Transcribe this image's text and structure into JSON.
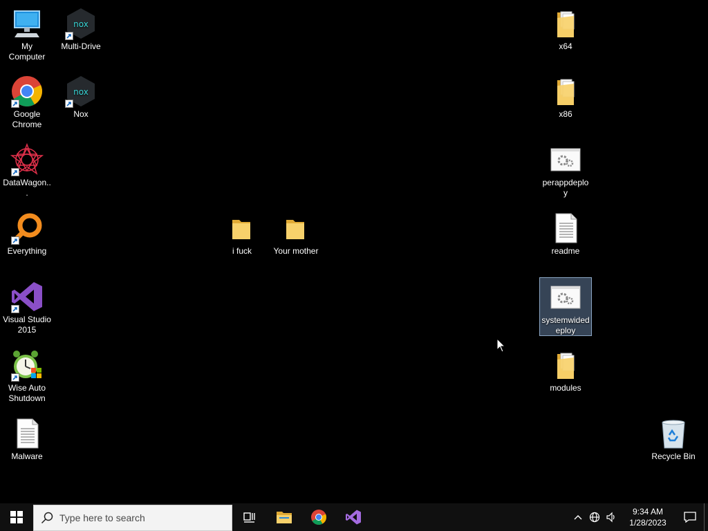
{
  "desktop": {
    "icons": [
      {
        "id": "my-computer",
        "label": "My Computer"
      },
      {
        "id": "multi-drive",
        "label": "Multi-Drive"
      },
      {
        "id": "google-chrome",
        "label": "Google Chrome"
      },
      {
        "id": "nox",
        "label": "Nox"
      },
      {
        "id": "datawagon",
        "label": "DataWagon..."
      },
      {
        "id": "everything",
        "label": "Everything"
      },
      {
        "id": "visual-studio",
        "label": "Visual Studio 2015"
      },
      {
        "id": "wise-auto-shutdown",
        "label": "Wise Auto Shutdown"
      },
      {
        "id": "malware",
        "label": "Malware"
      },
      {
        "id": "i-fuck",
        "label": "i fuck"
      },
      {
        "id": "your-mother",
        "label": "Your mother"
      },
      {
        "id": "x64",
        "label": "x64"
      },
      {
        "id": "x86",
        "label": "x86"
      },
      {
        "id": "perappdeploy",
        "label": "perappdeploy"
      },
      {
        "id": "readme",
        "label": "readme"
      },
      {
        "id": "systemwidedeploy",
        "label": "systemwidedeploy",
        "selected": true
      },
      {
        "id": "modules",
        "label": "modules"
      },
      {
        "id": "recycle-bin",
        "label": "Recycle Bin"
      }
    ]
  },
  "taskbar": {
    "search_placeholder": "Type here to search",
    "pinned": [
      "file-explorer-icon",
      "chrome-icon",
      "visual-studio-icon"
    ],
    "clock": {
      "time": "9:34 AM",
      "date": "1/28/2023"
    }
  },
  "colors": {
    "desktop_bg": "#000000",
    "taskbar_bg": "#101010",
    "folder": "#f3c75a",
    "selection": "#7896be"
  }
}
